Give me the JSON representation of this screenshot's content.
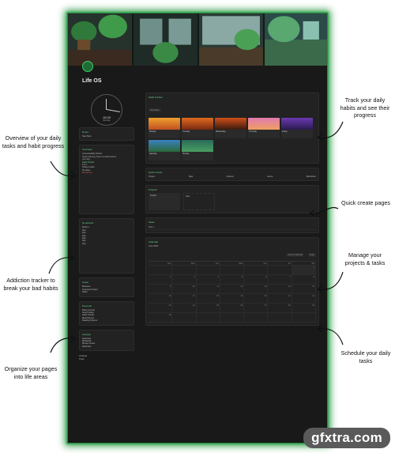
{
  "app": {
    "title": "Life OS",
    "clock_time": "15:32",
    "clock_day": "Monday"
  },
  "left": {
    "notes": {
      "title": "Notes",
      "item": "New Note"
    },
    "overview": {
      "title": "Overview",
      "lines": [
        "Accountability Partner",
        "Good morning, here is a quick look at",
        "your day",
        "Habit Tracker",
        "5 of 7",
        "Today's tasks",
        "No tasks",
        "Remaining"
      ]
    },
    "addiction": {
      "title": "No alcohol",
      "days": [
        "Week 1",
        "Day",
        "Day",
        "Day",
        "Day",
        "Day",
        "Day"
      ]
    },
    "areas": {
      "title": "Areas",
      "items": [
        "Business",
        "Financial Tracker",
        "Office"
      ]
    },
    "personal": {
      "title": "Personal",
      "items": [
        "Bullet Journal",
        "Goal Tracker",
        "Habit Tracker",
        "Meal Planner",
        "Reading Planner"
      ]
    },
    "lifestyle": {
      "title": "Lifestyle",
      "items": [
        "Notebook",
        "Bookshelf",
        "Movies Series",
        "Wardrobe"
      ]
    },
    "footer": [
      "Archived",
      "Trash"
    ]
  },
  "right": {
    "habit_tracker": {
      "title": "Habit Tracker",
      "new_week": "New Week",
      "days": [
        "Monday",
        "Tuesday",
        "Wednesday",
        "Thursday",
        "Friday",
        "Saturday",
        "Sunday"
      ]
    },
    "quick_create": {
      "title": "Quick Create",
      "items": [
        "Project",
        "Task",
        "Finance",
        "Event",
        "Resolution"
      ]
    },
    "projects": {
      "title": "Projects",
      "item": "Project",
      "new": "New"
    },
    "tasks": {
      "title": "Tasks",
      "item": "Task 1"
    },
    "calendar": {
      "title": "Calendar",
      "month": "June 2024",
      "open": "Open in Calendar",
      "today": "Today",
      "weekdays": [
        "Sun",
        "Mon",
        "Tue",
        "Wed",
        "Thu",
        "Fri",
        "Sat"
      ],
      "dates": [
        "",
        "",
        "",
        "",
        "",
        "",
        "1",
        "2",
        "3",
        "4",
        "5",
        "6",
        "7",
        "8",
        "9",
        "10",
        "11",
        "12",
        "13",
        "14",
        "15",
        "16",
        "17",
        "18",
        "19",
        "20",
        "21",
        "22",
        "23",
        "24",
        "25",
        "26",
        "27",
        "28",
        "29",
        "30",
        "",
        "",
        "",
        "",
        "",
        ""
      ]
    }
  },
  "annotations": {
    "a1": "Track your daily habits and see their progress",
    "a2": "Overview of your daily tasks and habit progress",
    "a3": "Quick create pages",
    "a4": "Manage your projects & tasks",
    "a5": "Addiction tracker to break your bad habits",
    "a6": "Schedule your daily tasks",
    "a7": "Organize your pages into life areas"
  },
  "watermark": "gfxtra.com",
  "colors": {
    "accent": "#3ccf5f",
    "bg": "#191919",
    "card": "#222222"
  }
}
